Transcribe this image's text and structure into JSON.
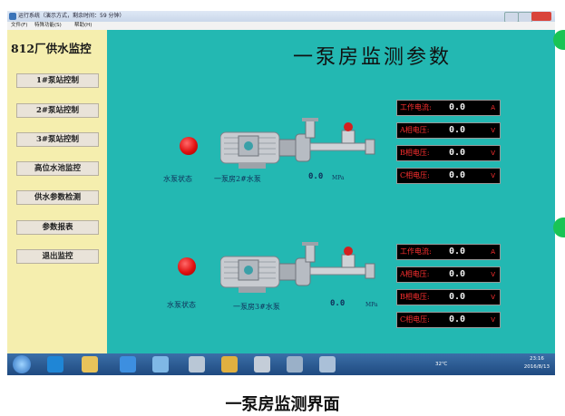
{
  "window": {
    "title": "运行系统（演示方式，剩余时间：59 分钟）",
    "menu": [
      "文件(F)",
      "特殊功能(S)",
      "帮助(H)"
    ]
  },
  "sidebar": {
    "title": "812厂供水监控",
    "items": [
      {
        "label": "1#泵站控制"
      },
      {
        "label": "2#泵站控制"
      },
      {
        "label": "3#泵站控制"
      },
      {
        "label": "高位水池监控"
      },
      {
        "label": "供水参数检测"
      },
      {
        "label": "参数报表"
      },
      {
        "label": "退出监控"
      }
    ]
  },
  "main": {
    "title": "一泵房监测参数",
    "pumps": [
      {
        "status_label": "水泵状态",
        "name": "一泵房2#水泵",
        "pressure_value": "0.0",
        "pressure_unit": "MPa",
        "readings": [
          {
            "label": "工作电流:",
            "value": "0.0",
            "unit": "A"
          },
          {
            "label": "A相电压:",
            "value": "0.0",
            "unit": "V"
          },
          {
            "label": "B相电压:",
            "value": "0.0",
            "unit": "V"
          },
          {
            "label": "C相电压:",
            "value": "0.0",
            "unit": "V"
          }
        ]
      },
      {
        "status_label": "水泵状态",
        "name": "一泵房3#水泵",
        "pressure_value": "0.0",
        "pressure_unit": "MPa",
        "readings": [
          {
            "label": "工作电流:",
            "value": "0.0",
            "unit": "A"
          },
          {
            "label": "A相电压:",
            "value": "0.0",
            "unit": "V"
          },
          {
            "label": "B相电压:",
            "value": "0.0",
            "unit": "V"
          },
          {
            "label": "C相电压:",
            "value": "0.0",
            "unit": "V"
          }
        ]
      }
    ],
    "status_color": "#e01010"
  },
  "taskbar": {
    "temperature": "32℃",
    "time": "23:16",
    "date": "2016/8/13"
  },
  "caption": "一泵房监测界面"
}
